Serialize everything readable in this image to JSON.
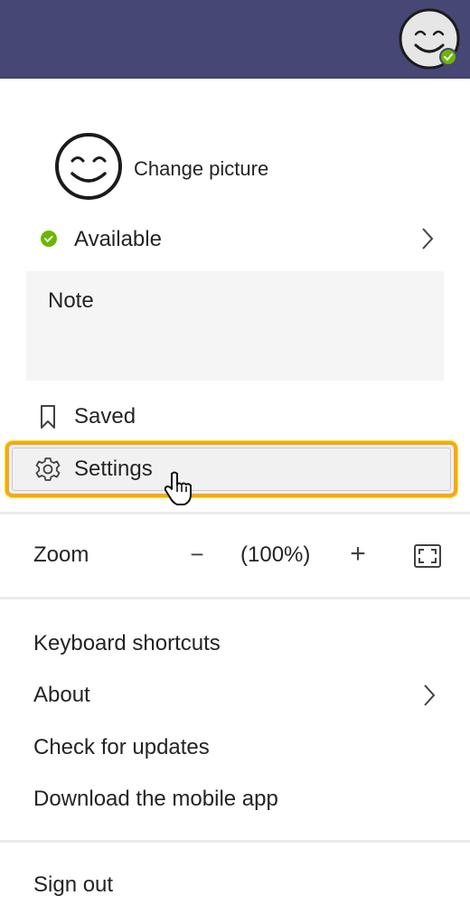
{
  "profile": {
    "change_picture": "Change picture",
    "status": "Available",
    "note_label": "Note"
  },
  "menu": {
    "saved": "Saved",
    "settings": "Settings"
  },
  "zoom": {
    "label": "Zoom",
    "minus": "−",
    "level": "(100%)",
    "plus": "+"
  },
  "links": {
    "keyboard_shortcuts": "Keyboard shortcuts",
    "about": "About",
    "check_updates": "Check for updates",
    "download_app": "Download the mobile app"
  },
  "sign_out": "Sign out",
  "colors": {
    "header": "#464775",
    "status_available": "#6bb700",
    "highlight": "#f5a623"
  },
  "icons": {
    "status": "check-circle-icon",
    "saved": "bookmark-icon",
    "settings": "gear-icon",
    "fullscreen": "fullscreen-icon",
    "chevron": "chevron-right-icon",
    "cursor": "hand-pointer-icon"
  }
}
